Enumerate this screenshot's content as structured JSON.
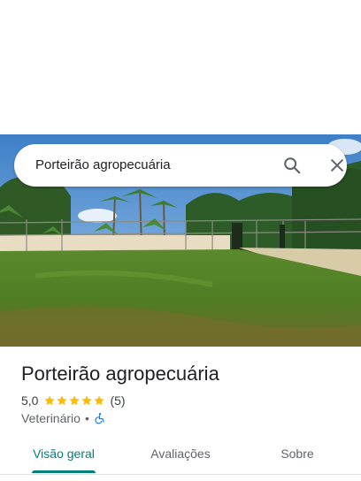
{
  "search": {
    "query": "Porteirão agropecuária",
    "search_icon": "search-icon",
    "close_icon": "close-icon"
  },
  "photo": {
    "description_icon": "place-photo"
  },
  "place": {
    "title": "Porteirão agropecuária",
    "rating": "5,0",
    "stars": 5,
    "review_count": "(5)",
    "category": "Veterinário",
    "separator": "•",
    "accessibility_icon": "wheelchair-icon"
  },
  "tabs": [
    {
      "label": "Visão geral",
      "active": true
    },
    {
      "label": "Avaliações",
      "active": false
    },
    {
      "label": "Sobre",
      "active": false
    }
  ],
  "colors": {
    "accent": "#007f7d",
    "star": "#fbbc04",
    "wheelchair": "#1a73e8"
  }
}
